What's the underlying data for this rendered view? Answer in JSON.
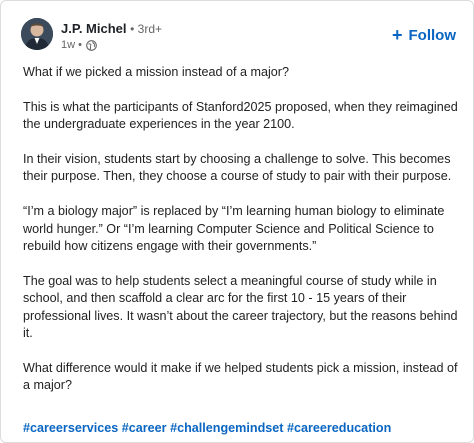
{
  "author": {
    "name": "J.P. Michel",
    "degree": "• 3rd+",
    "time": "1w •",
    "visibility_icon": "globe-icon"
  },
  "follow_label": "Follow",
  "post": {
    "paragraphs": [
      "What if we picked a mission instead of a major?",
      "This is what the participants of Stanford2025 proposed, when they reimagined the undergraduate experiences in the year 2100.",
      "In their vision, students start by choosing a challenge to solve. This becomes their purpose. Then, they choose a course of study to pair with their purpose.",
      "“I’m a biology major” is replaced by “I’m learning human biology to eliminate world hunger.” Or “I’m learning Computer Science and Political Science to rebuild how citizens engage with their governments.”",
      "The goal was to help students select a meaningful course of study while in school, and then scaffold a clear arc for the first 10 - 15 years of their professional lives. It wasn’t about the career trajectory, but the reasons behind it.",
      "What difference would it make if we helped students pick a mission, instead of a major?"
    ],
    "hashtags": [
      "#careerservices",
      "#career",
      "#challengemindset",
      "#careereducation"
    ]
  },
  "colors": {
    "accent": "#0a66c2",
    "text": "#1d2226",
    "muted": "#666666"
  }
}
